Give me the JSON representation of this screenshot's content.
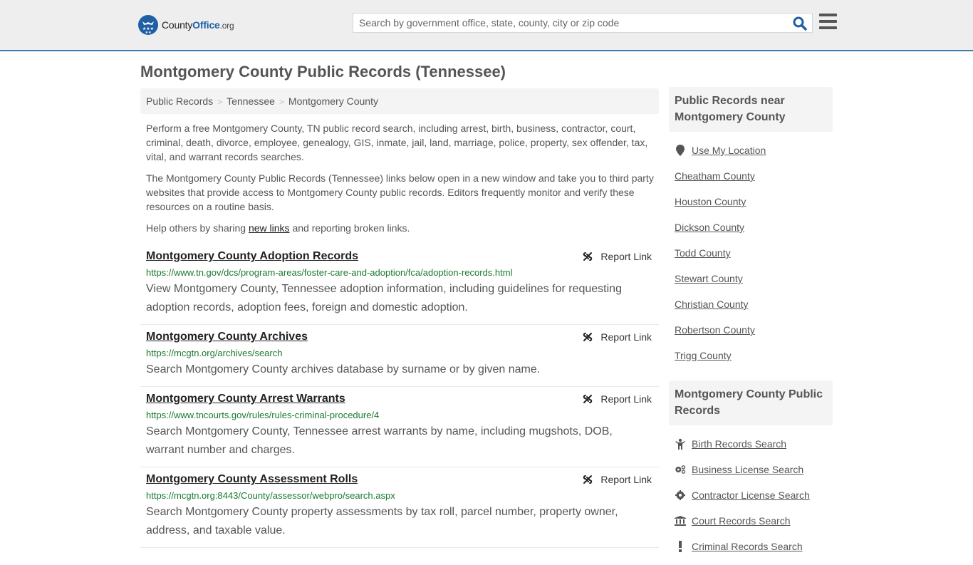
{
  "header": {
    "logo": {
      "name_prefix": "County",
      "name_brand": "Office",
      "tld": ".org"
    },
    "search": {
      "placeholder": "Search by government office, state, county, city or zip code",
      "value": ""
    },
    "brand_color": "#1f5fa6",
    "accent_border": "#3a7caa"
  },
  "page": {
    "title": "Montgomery County Public Records (Tennessee)"
  },
  "breadcrumb": [
    "Public Records",
    "Tennessee",
    "Montgomery County"
  ],
  "breadcrumb_sep": ">",
  "intro": {
    "p1": "Perform a free Montgomery County, TN public record search, including arrest, birth, business, contractor, court, criminal, death, divorce, employee, genealogy, GIS, inmate, jail, land, marriage, police, property, sex offender, tax, vital, and warrant records searches.",
    "p2": "The Montgomery County Public Records (Tennessee) links below open in a new window and take you to third party websites that provide access to Montgomery County public records. Editors frequently monitor and verify these resources on a routine basis.",
    "p3_before": "Help others by sharing ",
    "p3_link": "new links",
    "p3_after": " and reporting broken links."
  },
  "report_label": "Report Link",
  "records": [
    {
      "title": "Montgomery County Adoption Records",
      "url": "https://www.tn.gov/dcs/program-areas/foster-care-and-adoption/fca/adoption-records.html",
      "desc": "View Montgomery County, Tennessee adoption information, including guidelines for requesting adoption records, adoption fees, foreign and domestic adoption."
    },
    {
      "title": "Montgomery County Archives",
      "url": "https://mcgtn.org/archives/search",
      "desc": "Search Montgomery County archives database by surname or by given name."
    },
    {
      "title": "Montgomery County Arrest Warrants",
      "url": "https://www.tncourts.gov/rules/rules-criminal-procedure/4",
      "desc": "Search Montgomery County, Tennessee arrest warrants by name, including mugshots, DOB, warrant number and charges."
    },
    {
      "title": "Montgomery County Assessment Rolls",
      "url": "https://mcgtn.org:8443/County/assessor/webpro/search.aspx",
      "desc": "Search Montgomery County property assessments by tax roll, parcel number, property owner, address, and taxable value."
    }
  ],
  "sidebar": {
    "nearby": {
      "heading": "Public Records near Montgomery County",
      "location_label": "Use My Location",
      "counties": [
        "Cheatham County",
        "Houston County",
        "Dickson County",
        "Todd County",
        "Stewart County",
        "Christian County",
        "Robertson County",
        "Trigg County"
      ]
    },
    "local": {
      "heading": "Montgomery County Public Records",
      "items": [
        {
          "label": "Birth Records Search",
          "icon": "child-icon"
        },
        {
          "label": "Business License Search",
          "icon": "gears-icon"
        },
        {
          "label": "Contractor License Search",
          "icon": "gear-icon"
        },
        {
          "label": "Court Records Search",
          "icon": "courthouse-icon"
        },
        {
          "label": "Criminal Records Search",
          "icon": "exclamation-icon"
        }
      ]
    }
  }
}
